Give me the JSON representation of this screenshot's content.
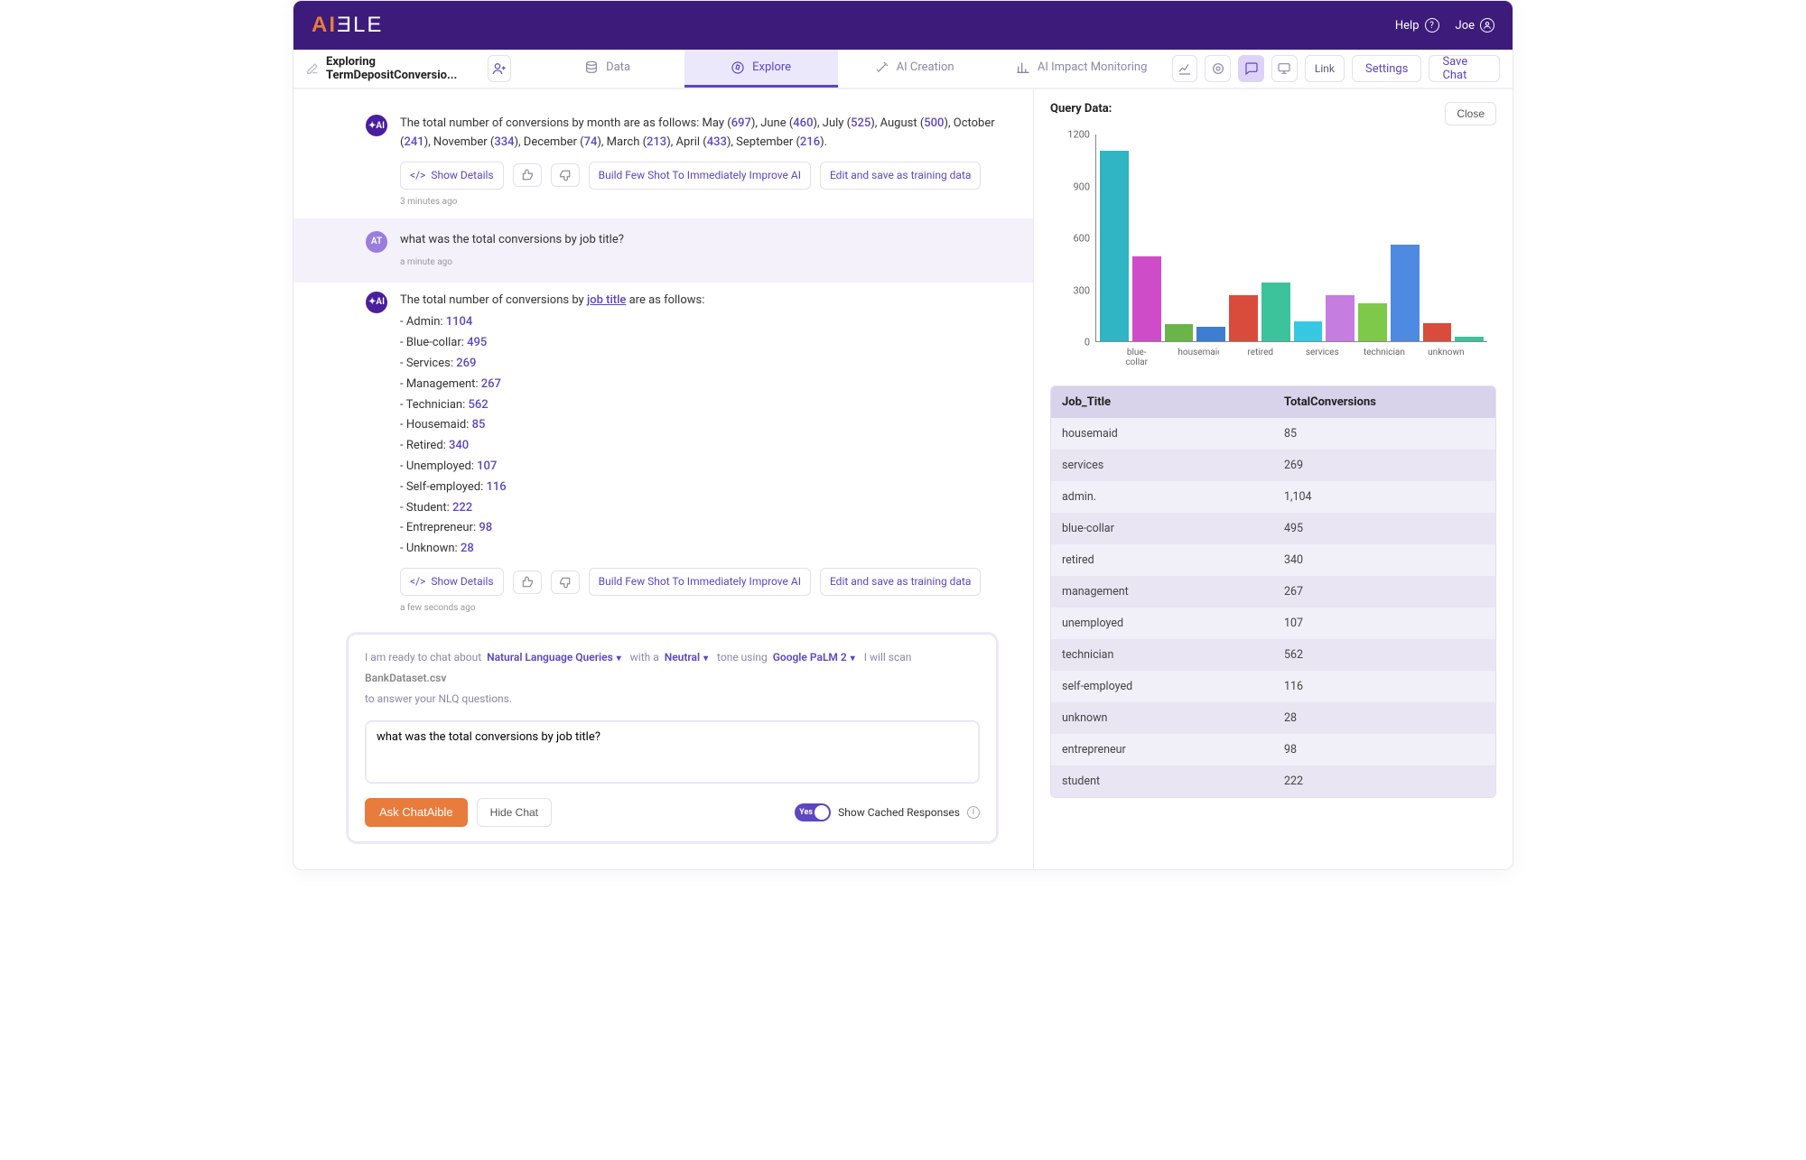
{
  "topbar": {
    "help_label": "Help",
    "user_name": "Joe"
  },
  "crumb": {
    "title": "Exploring TermDepositConversio..."
  },
  "tabs": {
    "data": "Data",
    "explore": "Explore",
    "ai_creation": "AI Creation",
    "monitor": "AI Impact Monitoring",
    "link": "Link",
    "settings": "Settings",
    "save_chat": "Save Chat"
  },
  "msg1": {
    "intro": "The total number of conversions by month are as follows: May (",
    "may": "697",
    "s1": "), June (",
    "jun": "460",
    "s2": "), July (",
    "jul": "525",
    "s3": "), August (",
    "aug": "500",
    "s4": "), October (",
    "oct": "241",
    "s5": "), November (",
    "nov": "334",
    "s6": "), December (",
    "dec": "74",
    "s7": "), March (",
    "mar": "213",
    "s8": "), April (",
    "apr": "433",
    "s9": "), September (",
    "sep": "216",
    "s10": ").",
    "ts": "3 minutes ago"
  },
  "userq": {
    "text": "what was the total conversions by job title?",
    "ts": "a minute ago",
    "avatar": "AT"
  },
  "msg2": {
    "intro_a": "The total number of conversions by ",
    "jt": "job title",
    "intro_b": " are as follows:",
    "items": [
      {
        "label": "Admin",
        "value": "1104"
      },
      {
        "label": "Blue-collar",
        "value": "495"
      },
      {
        "label": "Services",
        "value": "269"
      },
      {
        "label": "Management",
        "value": "267"
      },
      {
        "label": "Technician",
        "value": "562"
      },
      {
        "label": "Housemaid",
        "value": "85"
      },
      {
        "label": "Retired",
        "value": "340"
      },
      {
        "label": "Unemployed",
        "value": "107"
      },
      {
        "label": "Self-employed",
        "value": "116"
      },
      {
        "label": "Student",
        "value": "222"
      },
      {
        "label": "Entrepreneur",
        "value": "98"
      },
      {
        "label": "Unknown",
        "value": "28"
      }
    ],
    "ts": "a few seconds ago"
  },
  "actions": {
    "show_details": "Show Details",
    "build_few_shot": "Build Few Shot To Immediately Improve AI",
    "edit_save": "Edit and save as training data"
  },
  "composer": {
    "ready_a": "I am ready to chat about",
    "nlq": "Natural Language Queries",
    "ready_b": "with a",
    "tone": "Neutral",
    "ready_c": "tone using",
    "model": "Google PaLM 2",
    "ready_d": "I will scan",
    "file": "BankDataset.csv",
    "ready_e": "to answer your NLQ questions.",
    "input_value": "what was the total conversions by job title?",
    "ask_btn": "Ask ChatAible",
    "hide_btn": "Hide Chat",
    "toggle_on": "Yes",
    "cached": "Show Cached Responses"
  },
  "right": {
    "title": "Query Data:",
    "close": "Close",
    "table_h1": "Job_Title",
    "table_h2": "TotalConversions",
    "rows": [
      {
        "k": "housemaid",
        "v": "85"
      },
      {
        "k": "services",
        "v": "269"
      },
      {
        "k": "admin.",
        "v": "1,104"
      },
      {
        "k": "blue-collar",
        "v": "495"
      },
      {
        "k": "retired",
        "v": "340"
      },
      {
        "k": "management",
        "v": "267"
      },
      {
        "k": "unemployed",
        "v": "107"
      },
      {
        "k": "technician",
        "v": "562"
      },
      {
        "k": "self-employed",
        "v": "116"
      },
      {
        "k": "unknown",
        "v": "28"
      },
      {
        "k": "entrepreneur",
        "v": "98"
      },
      {
        "k": "student",
        "v": "222"
      }
    ]
  },
  "chart_data": {
    "type": "bar",
    "title": "",
    "xlabel": "",
    "ylabel": "",
    "ylim": [
      0,
      1200
    ],
    "yticks": [
      0,
      300,
      600,
      900,
      1200
    ],
    "categories": [
      "admin.",
      "blue-collar",
      "entrepreneur",
      "housemaid",
      "management",
      "retired",
      "self-employed",
      "services",
      "student",
      "technician",
      "unemployed",
      "unknown"
    ],
    "values": [
      1104,
      495,
      98,
      85,
      267,
      340,
      116,
      269,
      222,
      562,
      107,
      28
    ],
    "colors": [
      "#2fb5c4",
      "#cf4cc9",
      "#6ab54a",
      "#3e7ed1",
      "#d94b3b",
      "#3cc39b",
      "#36c8e2",
      "#c57ee0",
      "#7fc94a",
      "#4f8ae2",
      "#d94b3b",
      "#3cc39b"
    ],
    "x_tick_labels": [
      "blue-collar",
      "housemaid",
      "retired",
      "services",
      "technician",
      "unknown"
    ]
  }
}
